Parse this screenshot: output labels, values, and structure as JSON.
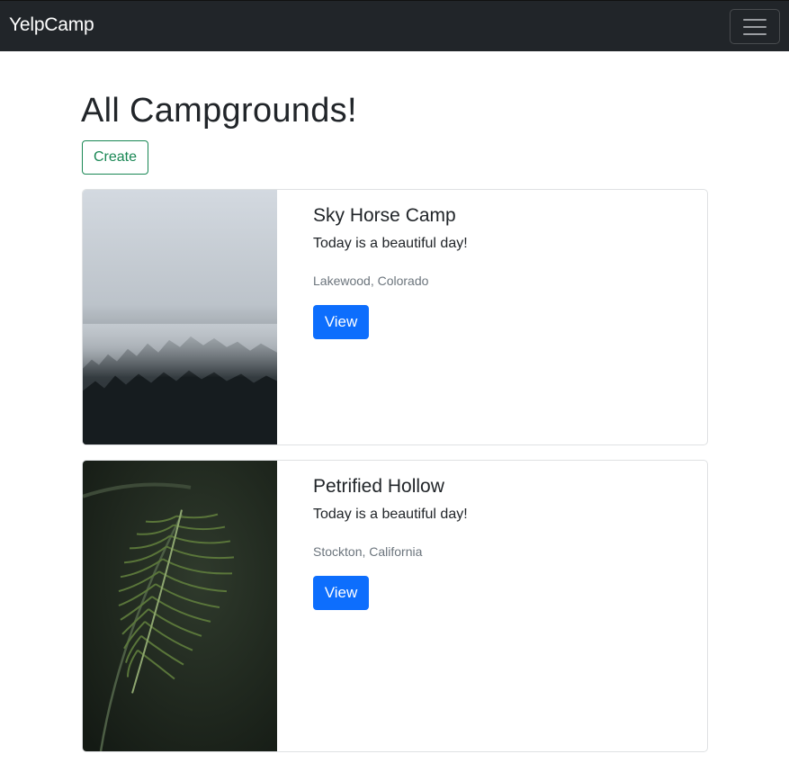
{
  "navbar": {
    "brand": "YelpCamp",
    "toggler_icon": "hamburger-menu-icon"
  },
  "main": {
    "title": "All Campgrounds!",
    "create_label": "Create"
  },
  "campgrounds": [
    {
      "title": "Sky Horse Camp",
      "description": "Today is a beautiful day!",
      "location": "Lakewood, Colorado",
      "view_label": "View",
      "image": "misty-forest-photo"
    },
    {
      "title": "Petrified Hollow",
      "description": "Today is a beautiful day!",
      "location": "Stockton, California",
      "view_label": "View",
      "image": "fern-leaf-photo"
    }
  ],
  "colors": {
    "navbar_bg": "#212529",
    "create_outline": "#198754",
    "view_button": "#0d6efd",
    "muted_text": "#6c757d"
  }
}
